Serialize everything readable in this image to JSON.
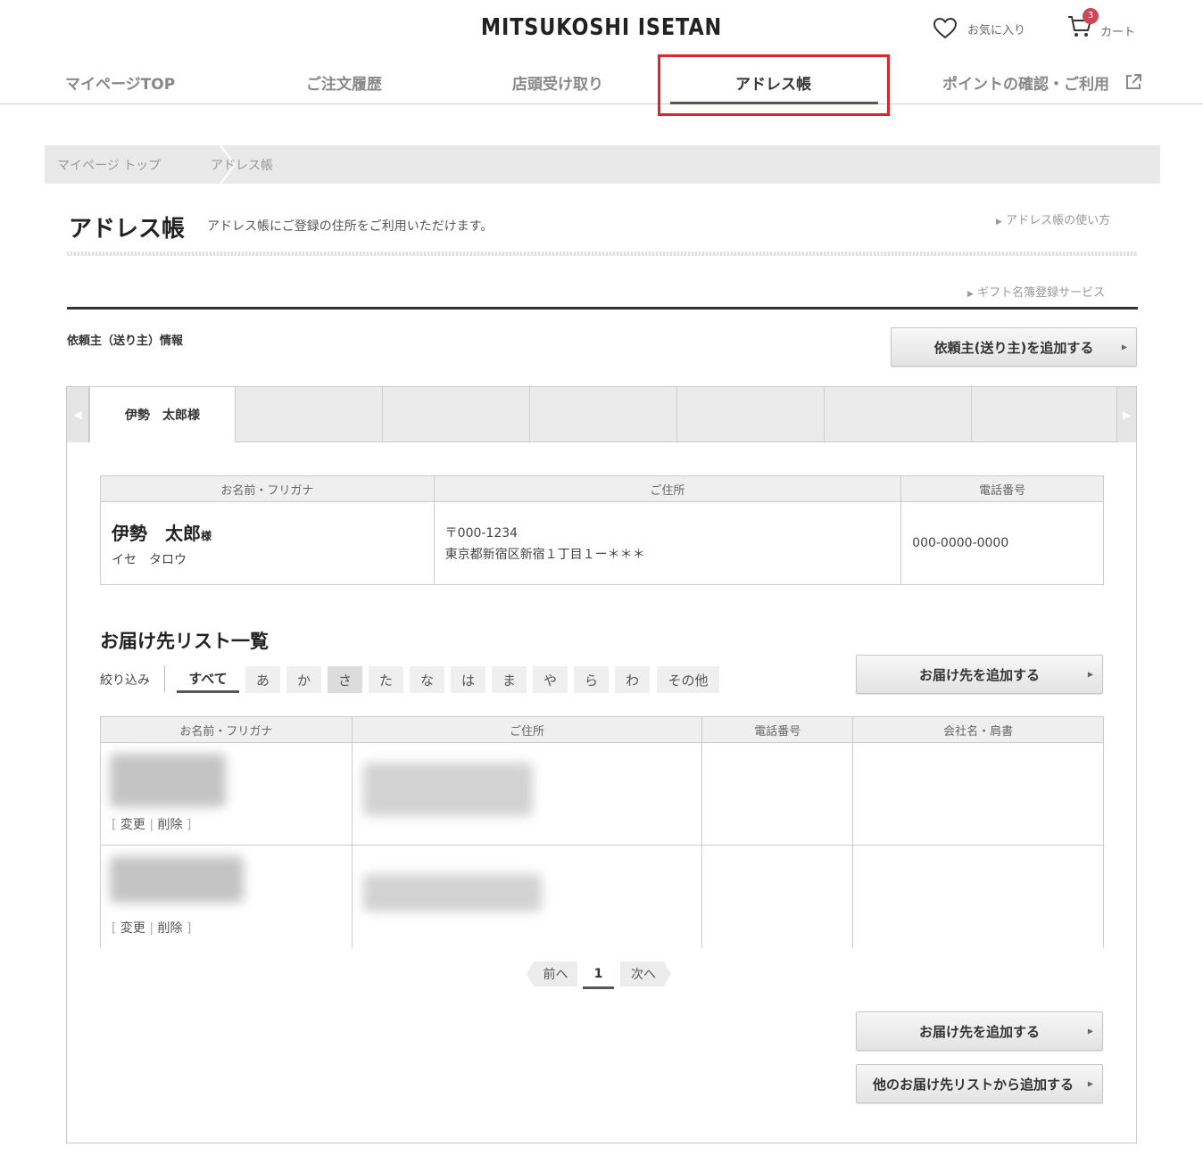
{
  "header": {
    "logo": "MITSUKOSHI ISETAN",
    "favorites_label": "お気に入り",
    "cart_label": "カート",
    "cart_count": "3"
  },
  "nav": {
    "tabs": [
      {
        "label": "マイページTOP"
      },
      {
        "label": "ご注文履歴"
      },
      {
        "label": "店頭受け取り"
      },
      {
        "label": "アドレス帳"
      },
      {
        "label": "ポイントの確認・ご利用"
      }
    ],
    "active": "アドレス帳"
  },
  "breadcrumb": {
    "items": [
      "マイページ トップ",
      "アドレス帳"
    ]
  },
  "page": {
    "title": "アドレス帳",
    "description": "アドレス帳にご登録の住所をご利用いただけます。",
    "help_link": "アドレス帳の使い方",
    "gift_link": "ギフト名簿登録サービス"
  },
  "sender": {
    "section_label": "依頼主（送り主）情報",
    "add_button": "依頼主(送り主)を追加する",
    "tab_name": "伊勢　太郎様",
    "table": {
      "headers": [
        "お名前・フリガナ",
        "ご住所",
        "電話番号"
      ],
      "name": "伊勢　太郎",
      "honorific": "様",
      "kana": "イセ　タロウ",
      "postal": "〒000-1234",
      "address": "東京都新宿区新宿１丁目１ー＊＊＊",
      "phone": "000-0000-0000"
    }
  },
  "delivery": {
    "title": "お届け先リスト一覧",
    "filter_label": "絞り込み",
    "filters": [
      "すべて",
      "あ",
      "か",
      "さ",
      "た",
      "な",
      "は",
      "ま",
      "や",
      "ら",
      "わ",
      "その他"
    ],
    "add_button": "お届け先を追加する",
    "headers": [
      "お名前・フリガナ",
      "ご住所",
      "電話番号",
      "会社名・肩書"
    ],
    "row_actions": {
      "edit": "変更",
      "delete": "削除"
    },
    "pager": {
      "prev": "前へ",
      "page": "1",
      "next": "次へ"
    },
    "bottom_add_button": "お届け先を追加する",
    "from_other_button": "他のお届け先リストから追加する"
  }
}
